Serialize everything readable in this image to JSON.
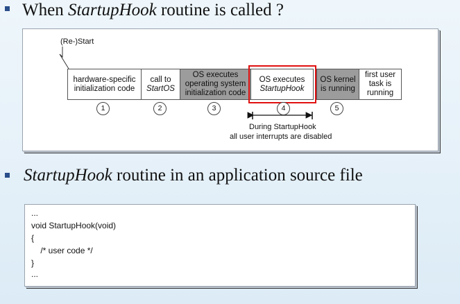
{
  "heading1": {
    "prefix": "When ",
    "italic": "StartupHook",
    "suffix": "  routine is called ?"
  },
  "diagram": {
    "restart_label": "(Re-)Start",
    "boxes": [
      {
        "lines": [
          "hardware-specific",
          "initialization code"
        ],
        "num": "1"
      },
      {
        "lines": [
          "call to"
        ],
        "italic": "StartOS",
        "num": "2"
      },
      {
        "lines": [
          "OS executes",
          "operating system",
          "initialization code"
        ],
        "num": "3"
      },
      {
        "lines": [
          "OS executes"
        ],
        "italic": "StartupHook",
        "num": "4"
      },
      {
        "lines": [
          "OS kernel",
          "is running"
        ],
        "num": "5"
      },
      {
        "lines": [
          "first user",
          "task is",
          "running"
        ]
      }
    ],
    "caption_line1": "During StartupHook",
    "caption_line2": "all user interrupts are disabled",
    "colors": {
      "gray_box": "#9c9c9c",
      "highlight": "#e01010"
    }
  },
  "heading2": {
    "italic": "StartupHook",
    "suffix": "  routine in an application source file"
  },
  "code": {
    "lines": [
      "...",
      "void StartupHook(void)",
      "{",
      "    /* user code */",
      "}",
      "..."
    ]
  }
}
